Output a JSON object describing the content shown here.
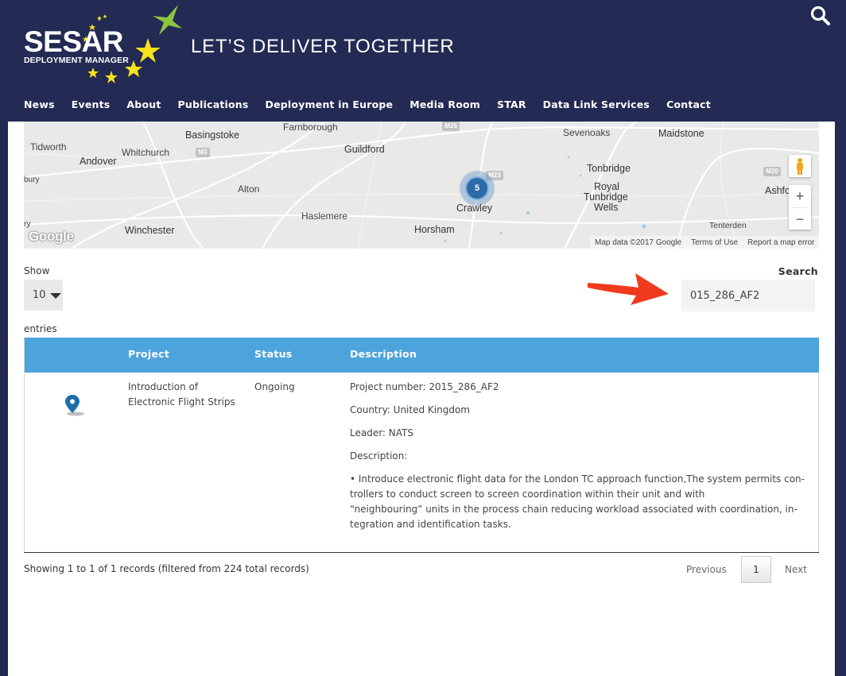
{
  "header": {
    "logo_text": "SESAR",
    "logo_subtext": "DEPLOYMENT MANAGER",
    "tagline": "LET’S DELIVER TOGETHER",
    "search_icon": "search-icon"
  },
  "nav": {
    "items": [
      {
        "label": "News"
      },
      {
        "label": "Events"
      },
      {
        "label": "About"
      },
      {
        "label": "Publications"
      },
      {
        "label": "Deployment in Europe"
      },
      {
        "label": "Media Room"
      },
      {
        "label": "STAR"
      },
      {
        "label": "Data Link Services"
      },
      {
        "label": "Contact"
      }
    ]
  },
  "map": {
    "places": [
      "Farnborough",
      "Basingstoke",
      "Tidworth",
      "Whitchurch",
      "Andover",
      "Guildford",
      "Sevenoaks",
      "Maidstone",
      "Tonbridge",
      "Royal",
      "Tunbridge",
      "Wells",
      "Alton",
      "Haslemere",
      "Crawley",
      "Winchester",
      "Horsham",
      "Tenterden",
      "Ashfo",
      "bury",
      "ry"
    ],
    "roads": [
      "M25",
      "M3",
      "A23",
      "M23",
      "A21",
      "A24",
      "M20"
    ],
    "cluster_count": "5",
    "attribution": [
      "Map data ©2017 Google",
      "Terms of Use",
      "Report a map error"
    ],
    "google_logo": "Google",
    "zoom_in": "+",
    "zoom_out": "−"
  },
  "controls": {
    "show_label": "Show",
    "page_length": "10",
    "entries_label": "entries",
    "search_label": "Search",
    "search_value": "015_286_AF2"
  },
  "table": {
    "headers": [
      "Project",
      "Status",
      "Description"
    ],
    "row": {
      "project_line1": "Introduction of",
      "project_line2": "Electronic Flight Strips",
      "status": "Ongoing",
      "project_number": "Project number: 2015_286_AF2",
      "country": "Country: United Kingdom",
      "leader": "Leader: NATS",
      "description_label": "Description:",
      "desc_line1": " • Introduce electronic flight data for the London TC approach function,The system permits con-",
      "desc_line2": "trollers to conduct screen to screen coordination within their unit and with",
      "desc_line3": "“neighbouring” units in the process chain reducing workload associated with coordination, in-",
      "desc_line4": "tegration and identification tasks."
    }
  },
  "footer": {
    "info": "Showing 1 to 1 of 1 records (filtered from 224 total records)",
    "previous": "Previous",
    "page": "1",
    "next": "Next"
  },
  "colors": {
    "header_bg": "#232a54",
    "table_header": "#4da3dc",
    "arrow": "#f03a1e",
    "star_yellow": "#f5e21c",
    "star_green": "#8cc63f",
    "pin": "#1e6fa8"
  }
}
